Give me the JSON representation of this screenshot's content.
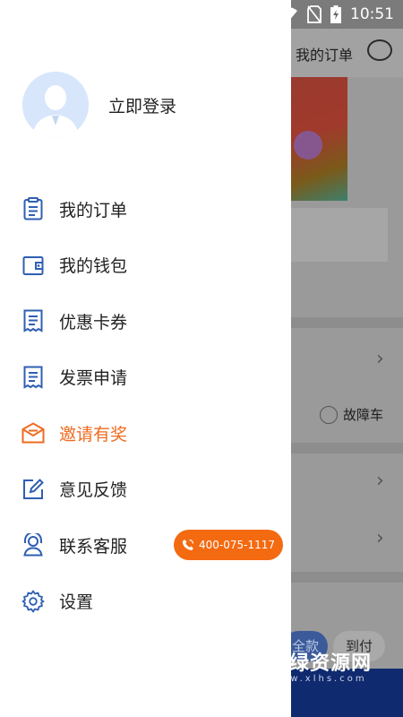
{
  "status_bar": {
    "time": "10:51",
    "left_icons": [
      "warning-icon",
      "a-icon"
    ],
    "right_icons": [
      "key-icon",
      "wifi-icon",
      "no-sim-icon",
      "battery-icon"
    ]
  },
  "background": {
    "my_orders": "我的订单",
    "fault_vehicle": "故障车",
    "tab_full_payment": "全款",
    "tab_pay_on_arrival": "到付",
    "watermark_name": "新绿资源网",
    "watermark_url": "www.xlhs.com"
  },
  "drawer": {
    "login_label": "立即登录",
    "items": [
      {
        "label": "我的订单",
        "icon": "order-icon"
      },
      {
        "label": "我的钱包",
        "icon": "wallet-icon"
      },
      {
        "label": "优惠卡券",
        "icon": "coupon-icon"
      },
      {
        "label": "发票申请",
        "icon": "invoice-icon"
      },
      {
        "label": "邀请有奖",
        "icon": "invite-icon"
      },
      {
        "label": "意见反馈",
        "icon": "feedback-icon"
      },
      {
        "label": "联系客服",
        "icon": "customer-service-icon"
      },
      {
        "label": "设置",
        "icon": "settings-icon"
      }
    ],
    "hotline": "400-075-1117"
  },
  "colors": {
    "accent_blue": "#2f5fb3",
    "highlight_orange": "#ef6b1f",
    "phone_button": "#f46a11"
  }
}
